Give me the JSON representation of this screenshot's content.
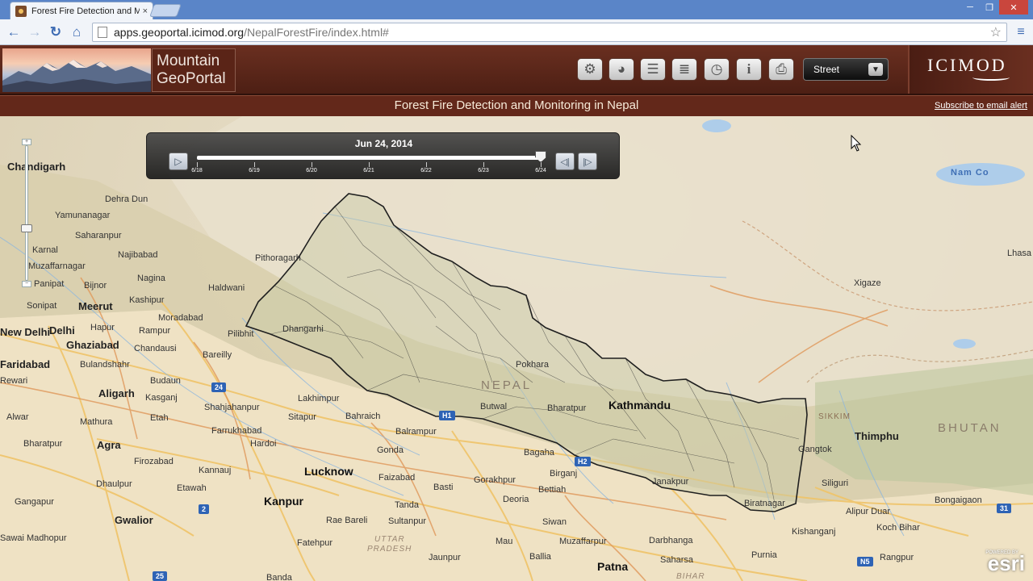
{
  "browser": {
    "tab_title": "Forest Fire Detection and Monitoring in Nepal",
    "tab_close": "×",
    "url_host": "apps.geoportal.icimod.org",
    "url_path": "/NepalForestFire/index.html#",
    "win_min": "─",
    "win_max": "❐",
    "win_close": "✕"
  },
  "header": {
    "logo_line1": "Mountain",
    "logo_line2": "GeoPortal",
    "tools": [
      {
        "name": "settings",
        "icon": "gear-icon",
        "glyph": "⚙"
      },
      {
        "name": "globe",
        "icon": "globe-icon",
        "glyph": "◕"
      },
      {
        "name": "layers",
        "icon": "layers-icon",
        "glyph": "☰"
      },
      {
        "name": "legend",
        "icon": "legend-icon",
        "glyph": "≣"
      },
      {
        "name": "time",
        "icon": "clock-icon",
        "glyph": "◷"
      },
      {
        "name": "info",
        "icon": "info-icon",
        "glyph": "i"
      },
      {
        "name": "print",
        "icon": "printer-icon",
        "glyph": "⎙"
      }
    ],
    "basemap_selected": "Street",
    "brand": "ICIMOD"
  },
  "title_bar": {
    "title": "Forest Fire Detection and Monitoring in Nepal",
    "subscribe": "Subscribe to email alert"
  },
  "time_slider": {
    "current_date": "Jun 24, 2014",
    "ticks": [
      "6/18",
      "6/19",
      "6/20",
      "6/21",
      "6/22",
      "6/23",
      "6/24"
    ],
    "position_fraction": 1.0
  },
  "map": {
    "labels": [
      {
        "text": "Chandigarh",
        "cls": "mid"
      },
      {
        "text": "Dehra Dun",
        "cls": ""
      },
      {
        "text": "Yamunanagar",
        "cls": ""
      },
      {
        "text": "Saharanpur",
        "cls": ""
      },
      {
        "text": "Karnal",
        "cls": ""
      },
      {
        "text": "Najibabad",
        "cls": ""
      },
      {
        "text": "Muzaffarnagar",
        "cls": ""
      },
      {
        "text": "Nagina",
        "cls": ""
      },
      {
        "text": "Panipat",
        "cls": ""
      },
      {
        "text": "Bijnor",
        "cls": ""
      },
      {
        "text": "Haldwani",
        "cls": ""
      },
      {
        "text": "Sonipat",
        "cls": ""
      },
      {
        "text": "Meerut",
        "cls": "mid"
      },
      {
        "text": "Kashipur",
        "cls": ""
      },
      {
        "text": "Moradabad",
        "cls": ""
      },
      {
        "text": "Hapur",
        "cls": ""
      },
      {
        "text": "Rampur",
        "cls": ""
      },
      {
        "text": "Pilibhit",
        "cls": ""
      },
      {
        "text": "New Delhi",
        "cls": "mid"
      },
      {
        "text": "Delhi",
        "cls": "mid"
      },
      {
        "text": "Ghaziabad",
        "cls": "mid"
      },
      {
        "text": "Chandausi",
        "cls": ""
      },
      {
        "text": "Bareilly",
        "cls": ""
      },
      {
        "text": "Faridabad",
        "cls": "mid"
      },
      {
        "text": "Bulandshahr",
        "cls": ""
      },
      {
        "text": "Rewari",
        "cls": ""
      },
      {
        "text": "Budaun",
        "cls": ""
      },
      {
        "text": "Aligarh",
        "cls": "mid"
      },
      {
        "text": "Kasganj",
        "cls": ""
      },
      {
        "text": "Lakhimpur",
        "cls": ""
      },
      {
        "text": "Shahjahanpur",
        "cls": ""
      },
      {
        "text": "Alwar",
        "cls": ""
      },
      {
        "text": "Etah",
        "cls": ""
      },
      {
        "text": "Sitapur",
        "cls": ""
      },
      {
        "text": "Bahraich",
        "cls": ""
      },
      {
        "text": "Mathura",
        "cls": ""
      },
      {
        "text": "Farrukhabad",
        "cls": ""
      },
      {
        "text": "Hardoi",
        "cls": ""
      },
      {
        "text": "Balrampur",
        "cls": ""
      },
      {
        "text": "Bharatpur",
        "cls": ""
      },
      {
        "text": "Agra",
        "cls": "mid"
      },
      {
        "text": "Gonda",
        "cls": ""
      },
      {
        "text": "Firozabad",
        "cls": ""
      },
      {
        "text": "Kannauj",
        "cls": ""
      },
      {
        "text": "Lucknow",
        "cls": "big"
      },
      {
        "text": "Dhaulpur",
        "cls": ""
      },
      {
        "text": "Etawah",
        "cls": ""
      },
      {
        "text": "Faizabad",
        "cls": ""
      },
      {
        "text": "Basti",
        "cls": ""
      },
      {
        "text": "Gangapur",
        "cls": ""
      },
      {
        "text": "Kanpur",
        "cls": "big"
      },
      {
        "text": "Tanda",
        "cls": ""
      },
      {
        "text": "Gwalior",
        "cls": "mid"
      },
      {
        "text": "Rae Bareli",
        "cls": ""
      },
      {
        "text": "Sultanpur",
        "cls": ""
      },
      {
        "text": "Sawai Madhopur",
        "cls": ""
      },
      {
        "text": "Fatehpur",
        "cls": ""
      },
      {
        "text": "UTTAR",
        "cls": "state"
      },
      {
        "text": "PRADESH",
        "cls": "state"
      },
      {
        "text": "Jaunpur",
        "cls": ""
      },
      {
        "text": "Banda",
        "cls": ""
      },
      {
        "text": "Pithoragarh",
        "cls": ""
      },
      {
        "text": "Dhangarhi",
        "cls": ""
      },
      {
        "text": "Pokhara",
        "cls": ""
      },
      {
        "text": "NEPAL",
        "cls": "country"
      },
      {
        "text": "Butwal",
        "cls": ""
      },
      {
        "text": "Bharatpur",
        "cls": ""
      },
      {
        "text": "Kathmandu",
        "cls": "big"
      },
      {
        "text": "Bagaha",
        "cls": ""
      },
      {
        "text": "Birganj",
        "cls": ""
      },
      {
        "text": "Gorakhpur",
        "cls": ""
      },
      {
        "text": "Bettiah",
        "cls": ""
      },
      {
        "text": "Janakpur",
        "cls": ""
      },
      {
        "text": "Deoria",
        "cls": ""
      },
      {
        "text": "Biratnagar",
        "cls": ""
      },
      {
        "text": "Siwan",
        "cls": ""
      },
      {
        "text": "Muzaffarpur",
        "cls": ""
      },
      {
        "text": "Darbhanga",
        "cls": ""
      },
      {
        "text": "Mau",
        "cls": ""
      },
      {
        "text": "Ballia",
        "cls": ""
      },
      {
        "text": "Saharsa",
        "cls": ""
      },
      {
        "text": "Purnia",
        "cls": ""
      },
      {
        "text": "Patna",
        "cls": "big"
      },
      {
        "text": "BIHAR",
        "cls": "state"
      },
      {
        "text": "Kishanganj",
        "cls": ""
      },
      {
        "text": "Siliguri",
        "cls": ""
      },
      {
        "text": "Alipur Duar",
        "cls": ""
      },
      {
        "text": "Koch Bihar",
        "cls": ""
      },
      {
        "text": "Rangpur",
        "cls": ""
      },
      {
        "text": "Bongaigaon",
        "cls": ""
      },
      {
        "text": "Gangtok",
        "cls": ""
      },
      {
        "text": "SIKKIM",
        "cls": "sikkim"
      },
      {
        "text": "Thimphu",
        "cls": "mid"
      },
      {
        "text": "BHUTAN",
        "cls": "country"
      },
      {
        "text": "Xigaze",
        "cls": ""
      },
      {
        "text": "Lhasa",
        "cls": ""
      },
      {
        "text": "Nam Co",
        "cls": "water"
      }
    ],
    "shields": [
      {
        "text": "24",
        "cls": "blue"
      },
      {
        "text": "H1",
        "cls": "blue"
      },
      {
        "text": "H2",
        "cls": "blue"
      },
      {
        "text": "2",
        "cls": "blue"
      },
      {
        "text": "25",
        "cls": "blue"
      },
      {
        "text": "N5",
        "cls": "blue"
      },
      {
        "text": "31",
        "cls": "blue"
      }
    ],
    "attribution_small": "POWERED BY",
    "attribution": "esri"
  },
  "colors": {
    "header_brown": "#5a2417",
    "title_bar": "#63281a",
    "accent_blue": "#3d6bb3"
  }
}
